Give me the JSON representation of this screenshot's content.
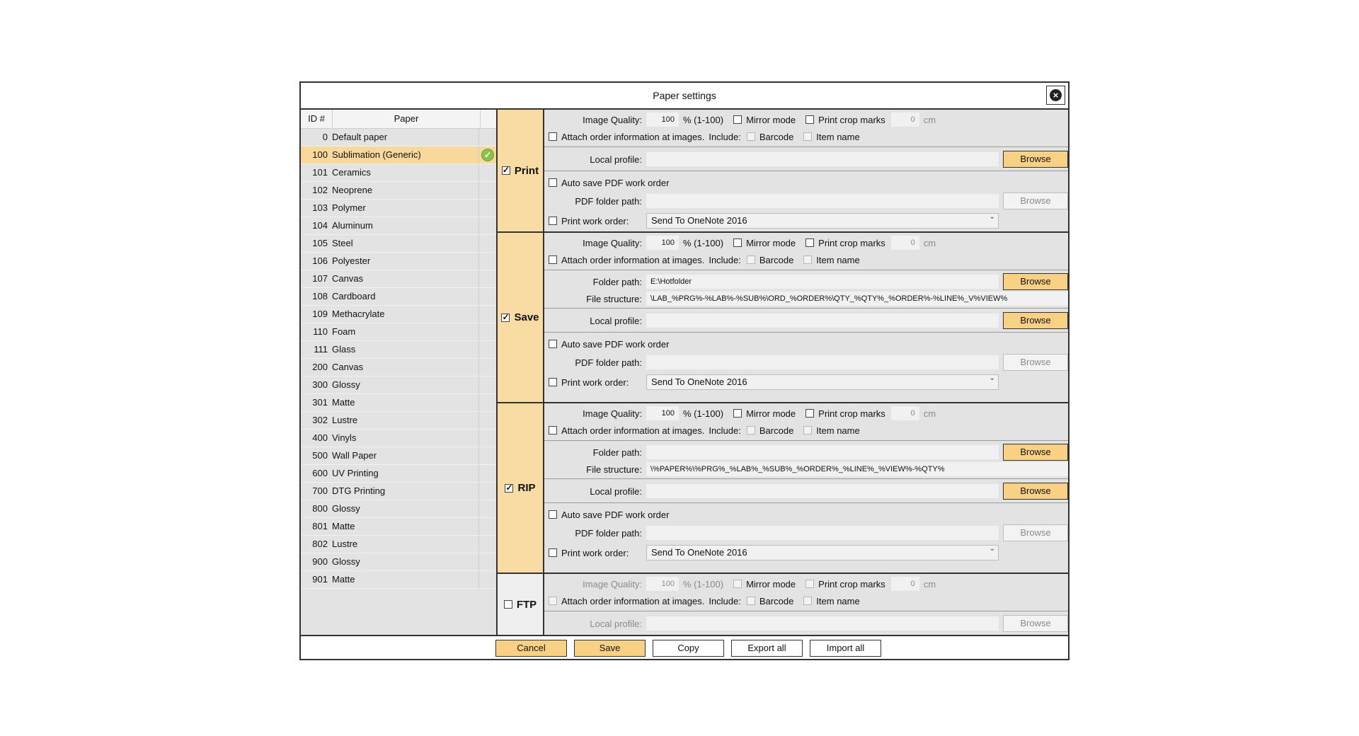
{
  "dialog": {
    "title": "Paper settings",
    "close_icon": "close-circle-icon"
  },
  "papers": {
    "header_id": "ID #",
    "header_name": "Paper",
    "rows": [
      {
        "id": "0",
        "name": "Default paper"
      },
      {
        "id": "100",
        "name": "Sublimation (Generic)",
        "selected": true,
        "status_icon": "check-circle-icon"
      },
      {
        "id": "101",
        "name": "Ceramics"
      },
      {
        "id": "102",
        "name": "Neoprene"
      },
      {
        "id": "103",
        "name": "Polymer"
      },
      {
        "id": "104",
        "name": "Aluminum"
      },
      {
        "id": "105",
        "name": "Steel"
      },
      {
        "id": "106",
        "name": "Polyester"
      },
      {
        "id": "107",
        "name": "Canvas"
      },
      {
        "id": "108",
        "name": "Cardboard"
      },
      {
        "id": "109",
        "name": "Methacrylate"
      },
      {
        "id": "110",
        "name": "Foam"
      },
      {
        "id": "111",
        "name": "Glass"
      },
      {
        "id": "200",
        "name": "Canvas"
      },
      {
        "id": "300",
        "name": "Glossy"
      },
      {
        "id": "301",
        "name": "Matte"
      },
      {
        "id": "302",
        "name": "Lustre"
      },
      {
        "id": "400",
        "name": "Vinyls"
      },
      {
        "id": "500",
        "name": "Wall Paper"
      },
      {
        "id": "600",
        "name": "UV Printing"
      },
      {
        "id": "700",
        "name": "DTG Printing"
      },
      {
        "id": "800",
        "name": "Glossy"
      },
      {
        "id": "801",
        "name": "Matte"
      },
      {
        "id": "802",
        "name": "Lustre"
      },
      {
        "id": "900",
        "name": "Glossy"
      },
      {
        "id": "901",
        "name": "Matte"
      }
    ]
  },
  "labels": {
    "image_quality": "Image Quality:",
    "quality_range": "% (1-100)",
    "mirror_mode": "Mirror mode",
    "print_crop_marks": "Print crop marks",
    "cm": "cm",
    "attach_info": "Attach order information at images.",
    "include": "Include:",
    "barcode": "Barcode",
    "item_name": "Item name",
    "local_profile": "Local profile:",
    "browse": "Browse",
    "auto_save_pdf": "Auto save PDF work order",
    "pdf_folder_path": "PDF folder path:",
    "print_work_order": "Print work order:",
    "folder_path": "Folder path:",
    "file_structure": "File structure:",
    "dropdown_arrow": "ˇ"
  },
  "sections": {
    "print": {
      "name": "Print",
      "enabled": true,
      "quality": "100",
      "crop_marks_value": "0",
      "local_profile": "",
      "pdf_folder": "",
      "work_order": "Send To OneNote 2016"
    },
    "save": {
      "name": "Save",
      "enabled": true,
      "quality": "100",
      "crop_marks_value": "0",
      "folder_path": "E:\\Hotfolder",
      "file_structure": "\\LAB_%PRG%-%LAB%-%SUB%\\ORD_%ORDER%\\QTY_%QTY%_%ORDER%-%LINE%_V%VIEW%",
      "local_profile": "",
      "pdf_folder": "",
      "work_order": "Send To OneNote 2016"
    },
    "rip": {
      "name": "RIP",
      "enabled": true,
      "quality": "100",
      "crop_marks_value": "0",
      "folder_path": "",
      "file_structure": "\\%PAPER%\\%PRG%_%LAB%_%SUB%_%ORDER%_%LINE%_%VIEW%-%QTY%",
      "local_profile": "",
      "pdf_folder": "",
      "work_order": "Send To OneNote 2016"
    },
    "ftp": {
      "name": "FTP",
      "enabled": false,
      "quality": "100",
      "crop_marks_value": "0",
      "local_profile": ""
    }
  },
  "footer": {
    "cancel": "Cancel",
    "save": "Save",
    "copy": "Copy",
    "export_all": "Export all",
    "import_all": "Import all"
  }
}
